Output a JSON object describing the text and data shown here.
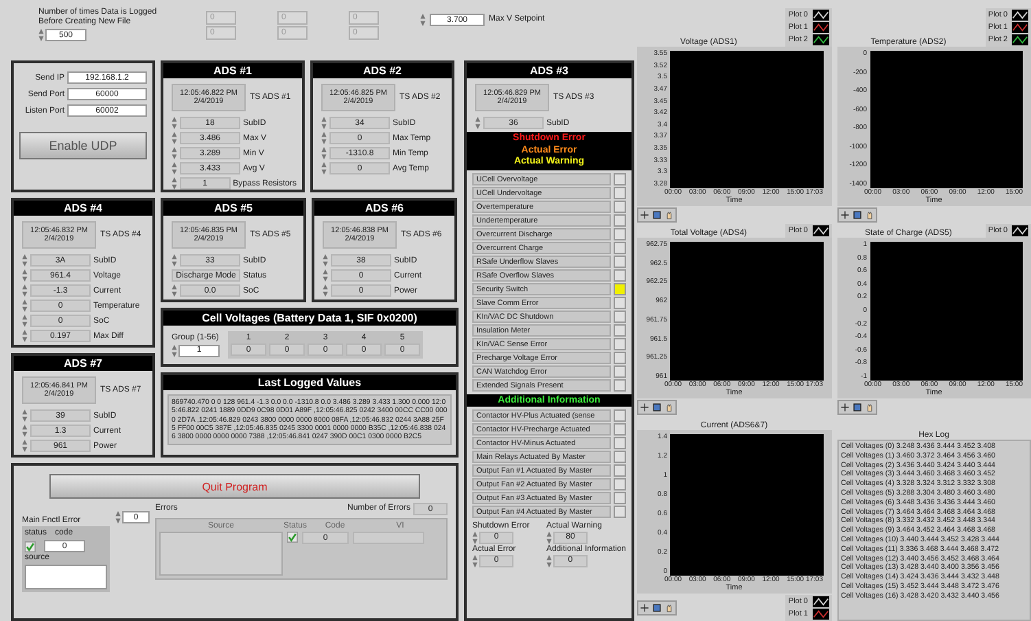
{
  "logging": {
    "label": "Number of times Data is Logged Before Creating New File",
    "value": "500"
  },
  "top_fields": [
    [
      "0",
      "0"
    ],
    [
      "0",
      "0"
    ],
    [
      "0",
      "0"
    ]
  ],
  "max_v_setpoint": {
    "label": "Max V Setpoint",
    "value": "3.700"
  },
  "udp": {
    "fields": [
      {
        "label": "Send IP",
        "value": "192.168.1.2"
      },
      {
        "label": "Send Port",
        "value": "60000"
      },
      {
        "label": "Listen Port",
        "value": "60002"
      }
    ],
    "button": "Enable UDP"
  },
  "ads_panels": [
    {
      "title": "ADS #1",
      "timestamp": "12:05:46.822 PM",
      "date": "2/4/2019",
      "ts_label": "TS ADS #1",
      "rows": [
        {
          "kind": "numeric",
          "value": "18",
          "label": "SubID"
        },
        {
          "kind": "numeric",
          "value": "3.486",
          "label": "Max V"
        },
        {
          "kind": "numeric",
          "value": "3.289",
          "label": "Min V"
        },
        {
          "kind": "numeric",
          "value": "3.433",
          "label": "Avg V"
        },
        {
          "kind": "numeric",
          "value": "1",
          "label": "Bypass Resistors"
        }
      ]
    },
    {
      "title": "ADS #2",
      "timestamp": "12:05:46.825 PM",
      "date": "2/4/2019",
      "ts_label": "TS ADS #2",
      "rows": [
        {
          "kind": "numeric",
          "value": "34",
          "label": "SubID"
        },
        {
          "kind": "numeric",
          "value": "0",
          "label": "Max Temp"
        },
        {
          "kind": "numeric",
          "value": "-1310.8",
          "label": "Min Temp"
        },
        {
          "kind": "numeric",
          "value": "0",
          "label": "Avg Temp"
        }
      ]
    },
    {
      "title": "ADS #4",
      "timestamp": "12:05:46.832 PM",
      "date": "2/4/2019",
      "ts_label": "TS ADS #4",
      "rows": [
        {
          "kind": "numeric",
          "value": "3A",
          "label": "SubID"
        },
        {
          "kind": "numeric",
          "value": "961.4",
          "label": "Voltage"
        },
        {
          "kind": "numeric",
          "value": "-1.3",
          "label": "Current"
        },
        {
          "kind": "numeric",
          "value": "0",
          "label": "Temperature"
        },
        {
          "kind": "numeric",
          "value": "0",
          "label": "SoC"
        },
        {
          "kind": "numeric",
          "value": "0.197",
          "label": "Max Diff"
        }
      ]
    },
    {
      "title": "ADS #5",
      "timestamp": "12:05:46.835 PM",
      "date": "2/4/2019",
      "ts_label": "TS ADS #5",
      "rows": [
        {
          "kind": "numeric",
          "value": "33",
          "label": "SubID"
        },
        {
          "kind": "string",
          "value": "Discharge Mode",
          "label": "Status"
        },
        {
          "kind": "numeric",
          "value": "0.0",
          "label": "SoC"
        }
      ]
    },
    {
      "title": "ADS #6",
      "timestamp": "12:05:46.838 PM",
      "date": "2/4/2019",
      "ts_label": "TS ADS #6",
      "rows": [
        {
          "kind": "numeric",
          "value": "38",
          "label": "SubID"
        },
        {
          "kind": "numeric",
          "value": "0",
          "label": "Current"
        },
        {
          "kind": "numeric",
          "value": "0",
          "label": "Power"
        }
      ]
    },
    {
      "title": "ADS #7",
      "timestamp": "12:05:46.841 PM",
      "date": "2/4/2019",
      "ts_label": "TS ADS #7",
      "rows": [
        {
          "kind": "numeric",
          "value": "39",
          "label": "SubID"
        },
        {
          "kind": "numeric",
          "value": "1.3",
          "label": "Current"
        },
        {
          "kind": "numeric",
          "value": "961",
          "label": "Power"
        }
      ]
    }
  ],
  "cell_voltages": {
    "title": "Cell Voltages (Battery Data 1, SIF 0x0200)",
    "group_label": "Group (1-56)",
    "group_value": "1",
    "columns": [
      "1",
      "2",
      "3",
      "4",
      "5"
    ],
    "values": [
      "0",
      "0",
      "0",
      "0",
      "0"
    ]
  },
  "last_logged": {
    "title": "Last Logged Values",
    "text": "869740.470 0 0 128 961.4 -1.3 0.0 0.0 -1310.8 0.0 3.486 3.289 3.433 1.300 0.000 12:05:46.822 0241 1889 0DD9 0C98 0D01 A89F ,12:05:46.825 0242 3400 00CC CC00 0000 2D7A ,12:05:46.829 0243 3800 0000 0000 8000 08FA ,12:05:46.832 0244 3A88 25F5 FF00 00C5 387E ,12:05:46.835 0245 3300 0001 0000 0000 B35C ,12:05:46.838 0246 3800 0000 0000 0000 7388 ,12:05:46.841 0247 390D 00C1 0300 0000 B2C5"
  },
  "quit": {
    "button": "Quit Program",
    "error_cluster": {
      "title": "Main Fnctl Error",
      "status_label": "status",
      "code_label": "code",
      "status": true,
      "code": "0",
      "source_label": "source"
    },
    "errors": {
      "label": "Errors",
      "index": "0",
      "count_label": "Number of Errors",
      "count": "0",
      "columns": [
        "Source",
        "Status",
        "Code",
        "VI"
      ],
      "status": true,
      "code": "0"
    }
  },
  "ads3": {
    "title": "ADS #3",
    "timestamp": "12:05:46.829 PM",
    "date": "2/4/2019",
    "ts_label": "TS ADS #3",
    "subid": {
      "value": "36",
      "label": "SubID"
    },
    "legend": [
      {
        "text": "Shutdown Error",
        "color": "#ff1a1a"
      },
      {
        "text": "Actual Error",
        "color": "#ff8a1a"
      },
      {
        "text": "Actual Warning",
        "color": "#f2f21a"
      }
    ],
    "errors": [
      {
        "label": "UCell Overvoltage",
        "on": false
      },
      {
        "label": "UCell Undervoltage",
        "on": false
      },
      {
        "label": "Overtemperature",
        "on": false
      },
      {
        "label": "Undertemperature",
        "on": false
      },
      {
        "label": "Overcurrent Discharge",
        "on": false
      },
      {
        "label": "Overcurrent Charge",
        "on": false
      },
      {
        "label": "RSafe Underflow Slaves",
        "on": false
      },
      {
        "label": "RSafe Overflow Slaves",
        "on": false
      },
      {
        "label": "Security Switch",
        "on": true
      },
      {
        "label": "Slave Comm Error",
        "on": false
      },
      {
        "label": "KIn/VAC DC Shutdown",
        "on": false
      },
      {
        "label": "Insulation Meter",
        "on": false
      },
      {
        "label": "KIn/VAC Sense Error",
        "on": false
      },
      {
        "label": "Precharge Voltage Error",
        "on": false
      },
      {
        "label": "CAN Watchdog Error",
        "on": false
      },
      {
        "label": "Extended Signals Present",
        "on": false
      }
    ],
    "additional_title": "Additional Information",
    "additional": [
      {
        "label": "Contactor HV-Plus Actuated (sense",
        "on": false
      },
      {
        "label": "Contactor HV-Precharge Actuated",
        "on": false
      },
      {
        "label": "Contactor HV-Minus Actuated",
        "on": false
      },
      {
        "label": "Main Relays Actuated By Master",
        "on": false
      },
      {
        "label": "Output Fan #1 Actuated By Master",
        "on": false
      },
      {
        "label": "Output Fan #2 Actuated By Master",
        "on": false
      },
      {
        "label": "Output Fan #3 Actuated By Master",
        "on": false
      },
      {
        "label": "Output Fan #4 Actuated By Master",
        "on": false
      }
    ],
    "codes": [
      {
        "label": "Shutdown Error",
        "value": "0"
      },
      {
        "label": "Actual Warning",
        "value": "80"
      },
      {
        "label": "Actual Error",
        "value": "0"
      },
      {
        "label": "Additional Information",
        "value": "0"
      }
    ]
  },
  "charts": [
    {
      "title": "Voltage (ADS1)",
      "legend_below": false,
      "legend": [
        {
          "name": "Plot 0",
          "color": "#d8d8d8"
        },
        {
          "name": "Plot 1",
          "color": "#d03030"
        },
        {
          "name": "Plot 2",
          "color": "#30c040"
        }
      ],
      "yticks": [
        "3.55",
        "3.52",
        "3.5",
        "3.47",
        "3.45",
        "3.42",
        "3.4",
        "3.37",
        "3.35",
        "3.33",
        "3.3",
        "3.28"
      ],
      "xticks": [
        "00:00",
        "03:00",
        "06:00",
        "09:00",
        "12:00",
        "15:00 17:03"
      ],
      "xlabel": "Time"
    },
    {
      "title": "Temperature (ADS2)",
      "legend_below": false,
      "legend": [
        {
          "name": "Plot 0",
          "color": "#d8d8d8"
        },
        {
          "name": "Plot 1",
          "color": "#d03030"
        },
        {
          "name": "Plot 2",
          "color": "#30c040"
        }
      ],
      "yticks": [
        "0",
        "-200",
        "-400",
        "-600",
        "-800",
        "-1000",
        "-1200",
        "-1400"
      ],
      "xticks": [
        "00:00",
        "03:00",
        "06:00",
        "09:00",
        "12:00",
        "15:00"
      ],
      "xlabel": "Time"
    },
    {
      "title": "Total Voltage (ADS4)",
      "legend_below": false,
      "legend": [
        {
          "name": "Plot 0",
          "color": "#d8d8d8"
        }
      ],
      "yticks": [
        "962.75",
        "962.5",
        "962.25",
        "962",
        "961.75",
        "961.5",
        "961.25",
        "961"
      ],
      "xticks": [
        "00:00",
        "03:00",
        "06:00",
        "09:00",
        "12:00",
        "15:00 17:03"
      ],
      "xlabel": "Time"
    },
    {
      "title": "State of Charge (ADS5)",
      "legend_below": false,
      "legend": [
        {
          "name": "Plot 0",
          "color": "#d8d8d8"
        }
      ],
      "yticks": [
        "1",
        "0.8",
        "0.6",
        "0.4",
        "0.2",
        "0",
        "-0.2",
        "-0.4",
        "-0.6",
        "-0.8",
        "-1"
      ],
      "xticks": [
        "00:00",
        "03:00",
        "06:00",
        "09:00",
        "12:00",
        "15:00"
      ],
      "xlabel": "Time"
    },
    {
      "title": "Current (ADS6&7)",
      "legend_below": true,
      "legend": [
        {
          "name": "Plot 0",
          "color": "#d8d8d8"
        },
        {
          "name": "Plot 1",
          "color": "#d03030"
        }
      ],
      "yticks": [
        "1.4",
        "1.2",
        "1",
        "0.8",
        "0.6",
        "0.4",
        "0.2",
        "0"
      ],
      "xticks": [
        "00:00",
        "03:00",
        "06:00",
        "09:00",
        "12:00",
        "15:00 17:03"
      ],
      "xlabel": "Time"
    }
  ],
  "hex_log": {
    "title": "Hex Log",
    "lines": [
      "Cell Voltages (0) 3.248 3.436 3.444 3.452 3.408",
      "Cell Voltages (1) 3.460 3.372 3.464 3.456 3.460",
      "Cell Voltages (2) 3.436 3.440 3.424 3.440 3.444",
      "Cell Voltages (3) 3.444 3.460 3.468 3.460 3.452",
      "Cell Voltages (4) 3.328 3.324 3.312 3.332 3.308",
      "Cell Voltages (5) 3.288 3.304 3.480 3.460 3.480",
      "Cell Voltages (6) 3.448 3.436 3.436 3.444 3.460",
      "Cell Voltages (7) 3.464 3.464 3.468 3.464 3.468",
      "Cell Voltages (8) 3.332 3.432 3.452 3.448 3.344",
      "Cell Voltages (9) 3.464 3.452 3.464 3.468 3.468",
      "Cell Voltages (10) 3.440 3.444 3.452 3.428 3.444",
      "Cell Voltages (11) 3.336 3.468 3.444 3.468 3.472",
      "Cell Voltages (12) 3.440 3.456 3.452 3.468 3.464",
      "Cell Voltages (13) 3.428 3.440 3.400 3.356 3.456",
      "Cell Voltages (14) 3.424 3.436 3.444 3.432 3.448",
      "Cell Voltages (15) 3.452 3.444 3.448 3.472 3.476",
      "Cell Voltages (16) 3.428 3.420 3.432 3.440 3.456"
    ]
  }
}
